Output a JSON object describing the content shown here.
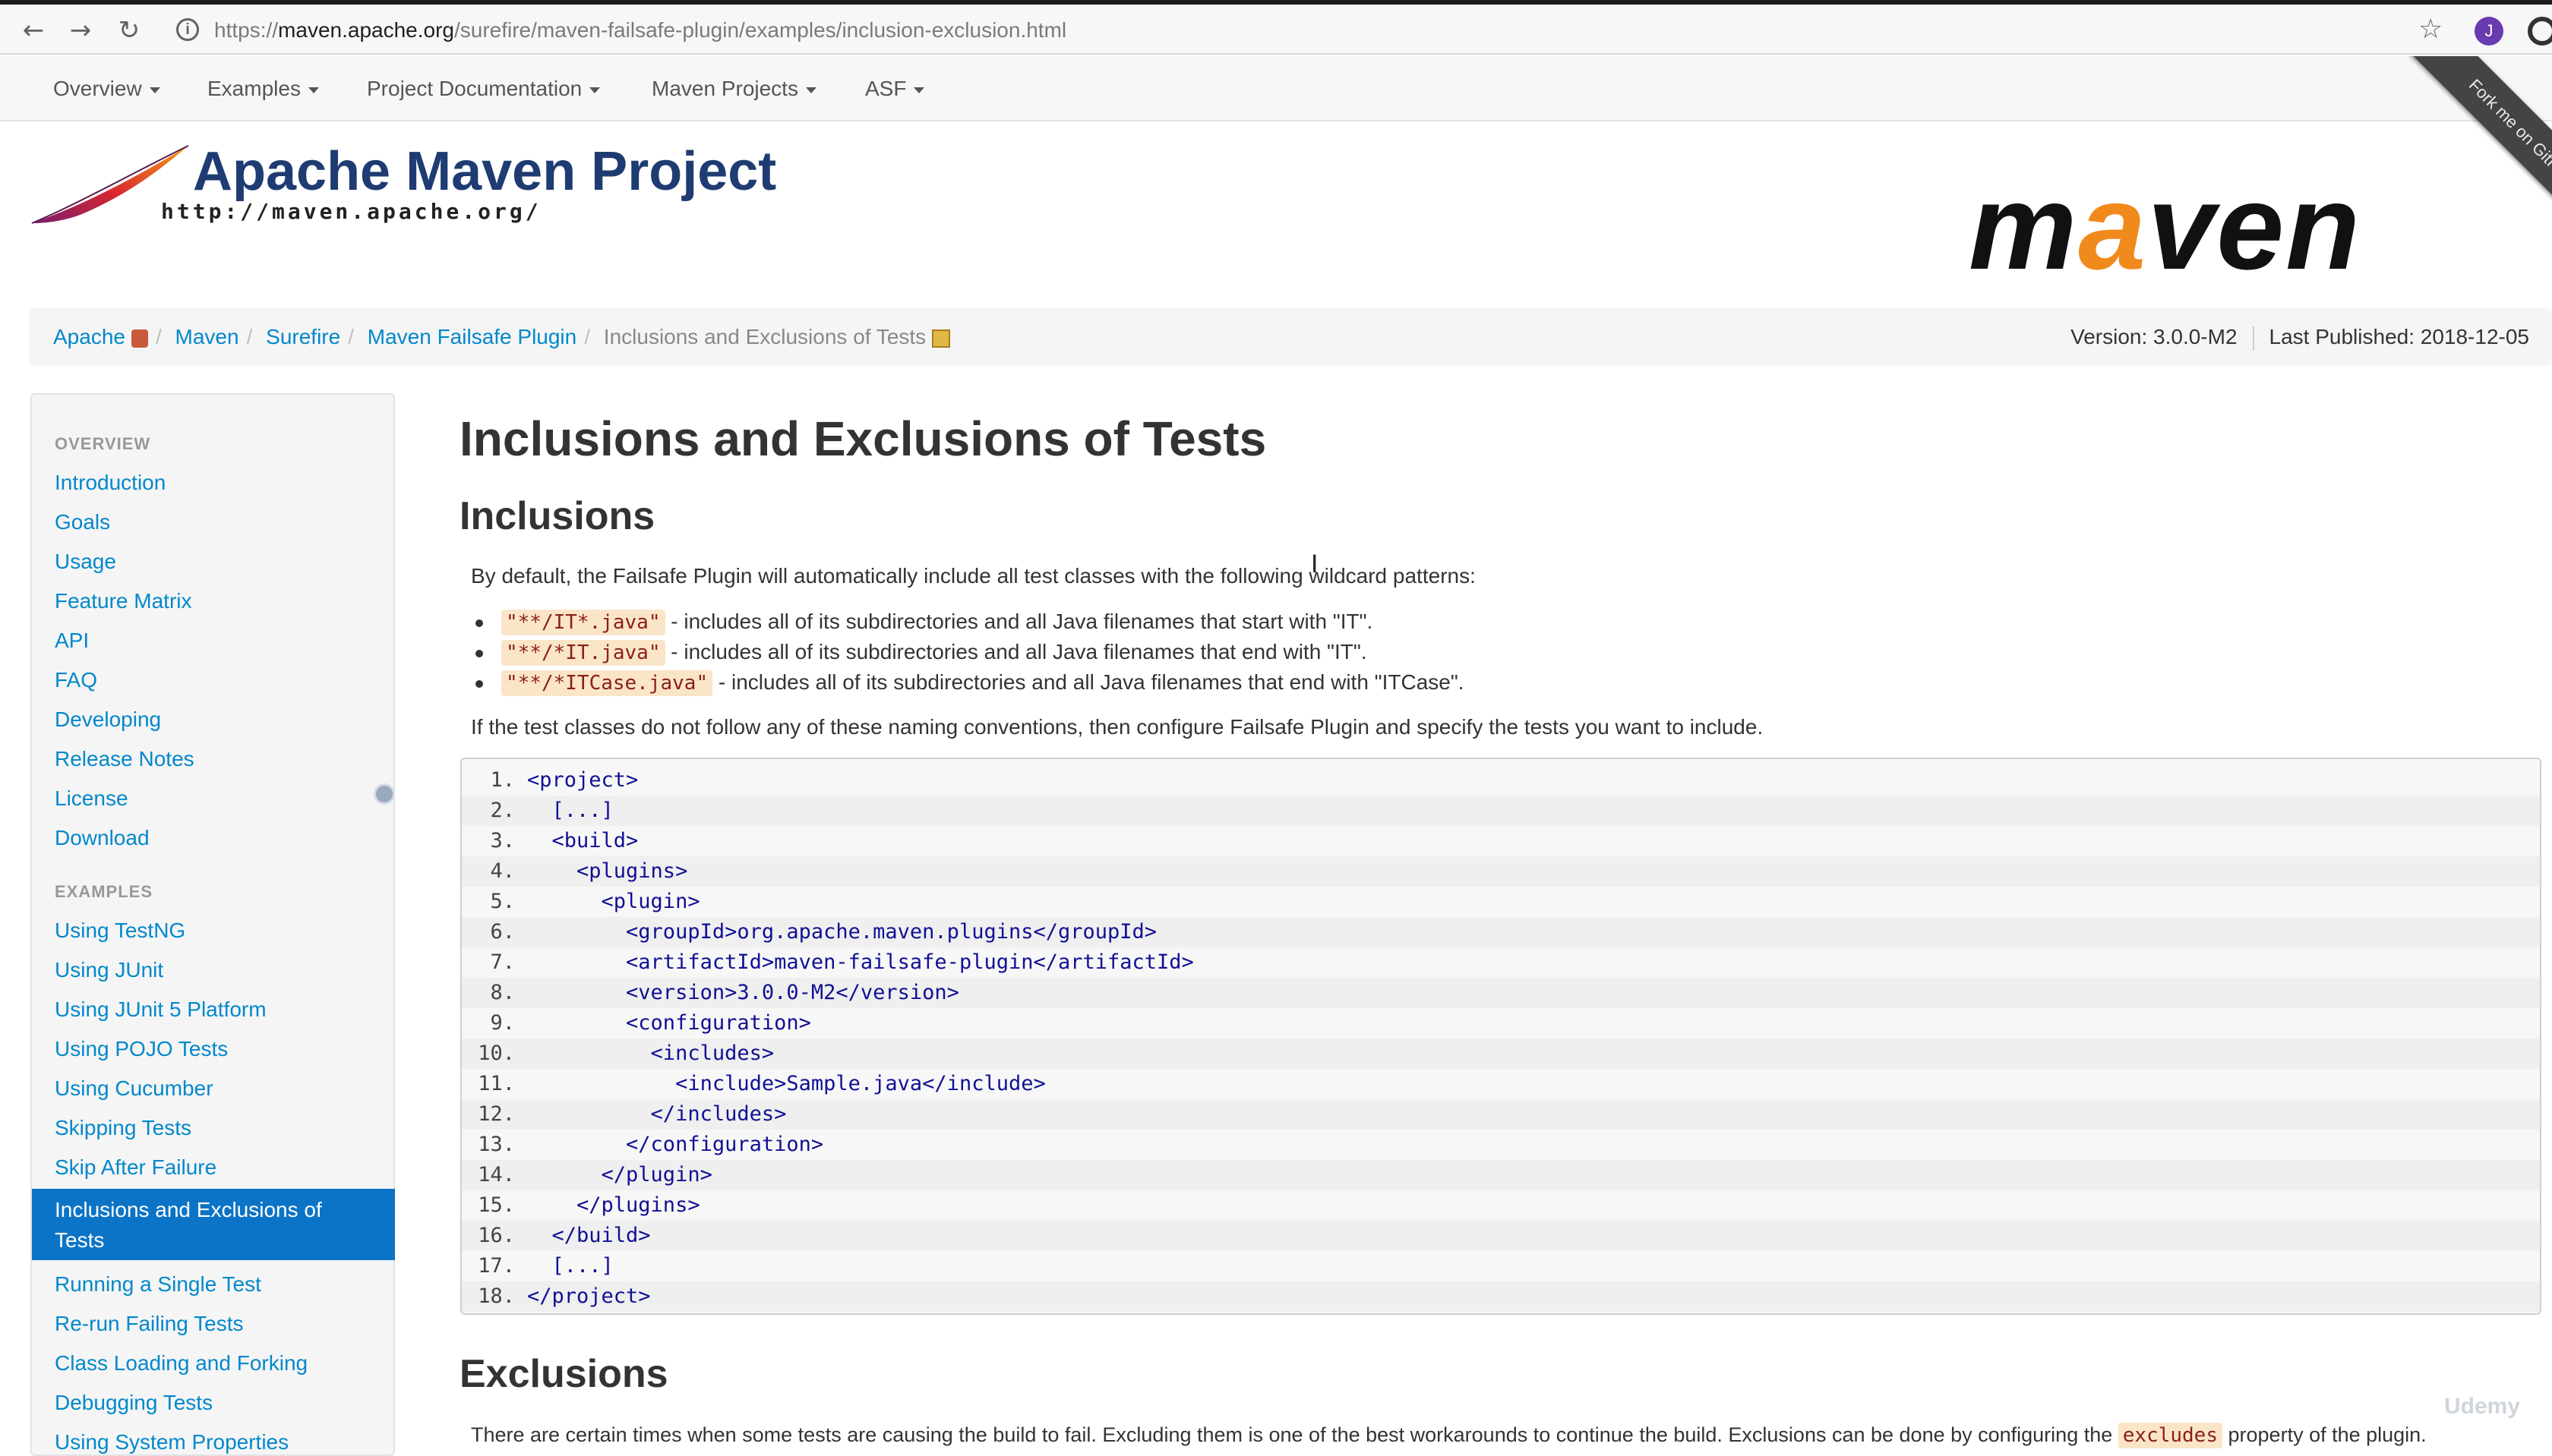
{
  "browser": {
    "url_prefix": "https://",
    "url_domain": "maven.apache.org",
    "url_path": "/surefire/maven-failsafe-plugin/examples/inclusion-exclusion.html",
    "back": "←",
    "forward": "→",
    "reload": "↻",
    "info": "i",
    "star": "☆",
    "profile": "J"
  },
  "topnav": {
    "items": [
      {
        "label": "Overview"
      },
      {
        "label": "Examples"
      },
      {
        "label": "Project Documentation"
      },
      {
        "label": "Maven Projects"
      },
      {
        "label": "ASF"
      }
    ],
    "ribbon": "Fork me on GitHub"
  },
  "header": {
    "title": "Apache Maven Project",
    "url": "http://maven.apache.org/",
    "logo_pre": "m",
    "logo_a": "a",
    "logo_post": "ven"
  },
  "breadcrumb": {
    "items": [
      "Apache",
      "Maven",
      "Surefire",
      "Maven Failsafe Plugin"
    ],
    "current": "Inclusions and Exclusions of Tests",
    "separator": "/",
    "version": "Version: 3.0.0-M2",
    "published": "Last Published: 2018-12-05"
  },
  "sidebar": {
    "overview_header": "OVERVIEW",
    "overview": [
      "Introduction",
      "Goals",
      "Usage",
      "Feature Matrix",
      "API",
      "FAQ",
      "Developing",
      "Release Notes",
      "License",
      "Download"
    ],
    "examples_header": "EXAMPLES",
    "examples": [
      "Using TestNG",
      "Using JUnit",
      "Using JUnit 5 Platform",
      "Using POJO Tests",
      "Using Cucumber",
      "Skipping Tests",
      "Skip After Failure"
    ],
    "active": "Inclusions and Exclusions of Tests",
    "after": [
      "Running a Single Test",
      "Re-run Failing Tests",
      "Class Loading and Forking",
      "Debugging Tests",
      "Using System Properties"
    ]
  },
  "main": {
    "title": "Inclusions and Exclusions of Tests",
    "inclusions_heading": "Inclusions",
    "intro": "By default, the Failsafe Plugin will automatically include all test classes with the following wildcard patterns:",
    "bullets": [
      {
        "code": "\"**/IT*.java\"",
        "text": " - includes all of its subdirectories and all Java filenames that start with \"IT\"."
      },
      {
        "code": "\"**/*IT.java\"",
        "text": " - includes all of its subdirectories and all Java filenames that end with \"IT\"."
      },
      {
        "code": "\"**/*ITCase.java\"",
        "text": " - includes all of its subdirectories and all Java filenames that end with \"ITCase\"."
      }
    ],
    "followup": "If the test classes do not follow any of these naming conventions, then configure Failsafe Plugin and specify the tests you want to include.",
    "code": [
      {
        "n": "1.",
        "t": "<project>"
      },
      {
        "n": "2.",
        "t": "  [...]"
      },
      {
        "n": "3.",
        "t": "  <build>"
      },
      {
        "n": "4.",
        "t": "    <plugins>"
      },
      {
        "n": "5.",
        "t": "      <plugin>"
      },
      {
        "n": "6.",
        "t": "        <groupId>org.apache.maven.plugins</groupId>"
      },
      {
        "n": "7.",
        "t": "        <artifactId>maven-failsafe-plugin</artifactId>"
      },
      {
        "n": "8.",
        "t": "        <version>3.0.0-M2</version>"
      },
      {
        "n": "9.",
        "t": "        <configuration>"
      },
      {
        "n": "10.",
        "t": "          <includes>"
      },
      {
        "n": "11.",
        "t": "            <include>Sample.java</include>"
      },
      {
        "n": "12.",
        "t": "          </includes>"
      },
      {
        "n": "13.",
        "t": "        </configuration>"
      },
      {
        "n": "14.",
        "t": "      </plugin>"
      },
      {
        "n": "15.",
        "t": "    </plugins>"
      },
      {
        "n": "16.",
        "t": "  </build>"
      },
      {
        "n": "17.",
        "t": "  [...]"
      },
      {
        "n": "18.",
        "t": "</project>"
      }
    ],
    "exclusions_heading": "Exclusions",
    "exclusions_intro": "There are certain times when some tests are causing the build to fail. Excluding them is one of the best workarounds to continue the build. Exclusions can be done by configuring the",
    "exclusions_code": "excludes",
    "exclusions_tail": "property of the plugin."
  },
  "watermark": "Udemy",
  "colors": {
    "link": "#0088cc",
    "active": "#0c74c6",
    "title": "#1e3c72",
    "logo_accent": "#f08a1c"
  }
}
